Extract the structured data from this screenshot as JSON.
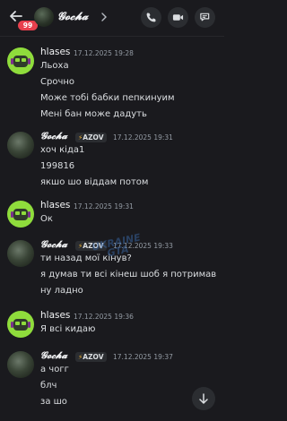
{
  "header": {
    "title": "𝓖𝓸𝓬𝓱𝓪",
    "unread_count": "99"
  },
  "messages": [
    {
      "author": "hlases",
      "time": "17.12.2025 19:28",
      "lines": [
        "Льоха",
        "Срочно",
        "Може тобі бабки пепкинуим",
        "Мені бан може дадуть"
      ]
    },
    {
      "author": "𝓖𝓸𝓬𝓱𝓪",
      "tag": "AZOV",
      "time": "17.12.2025 19:31",
      "lines": [
        "хоч кіда1",
        "199816",
        "якшо шо віддам потом"
      ]
    },
    {
      "author": "hlases",
      "time": "17.12.2025 19:31",
      "lines": [
        "Ок"
      ]
    },
    {
      "author": "𝓖𝓸𝓬𝓱𝓪",
      "tag": "AZOV",
      "time": "17.12.2025 19:33",
      "lines": [
        "ти назад мої кінув?",
        "я думав ти всі кінеш шоб я потримав",
        "ну ладно"
      ]
    },
    {
      "author": "hlases",
      "time": "17.12.2025 19:36",
      "lines": [
        "Я всі кидаю"
      ]
    },
    {
      "author": "𝓖𝓸𝓬𝓱𝓪",
      "tag": "AZOV",
      "time": "17.12.2025 19:37",
      "lines": [
        "а чогг",
        "блч",
        "за шо"
      ]
    }
  ],
  "watermark": {
    "line1": "UKRAINE",
    "line2": "GTA"
  },
  "icons": {
    "back": "arrow-left-icon",
    "call": "phone-icon",
    "video": "video-camera-icon",
    "threads": "threads-icon",
    "scroll": "arrow-down-icon",
    "tag": "lightning-bolt-icon"
  },
  "colors": {
    "background": "#1a1a1e",
    "badge": "#e8404d",
    "avatar_green": "#8fdc3c",
    "tag_bolt": "#f0b232",
    "timestamp": "#949ba4"
  }
}
